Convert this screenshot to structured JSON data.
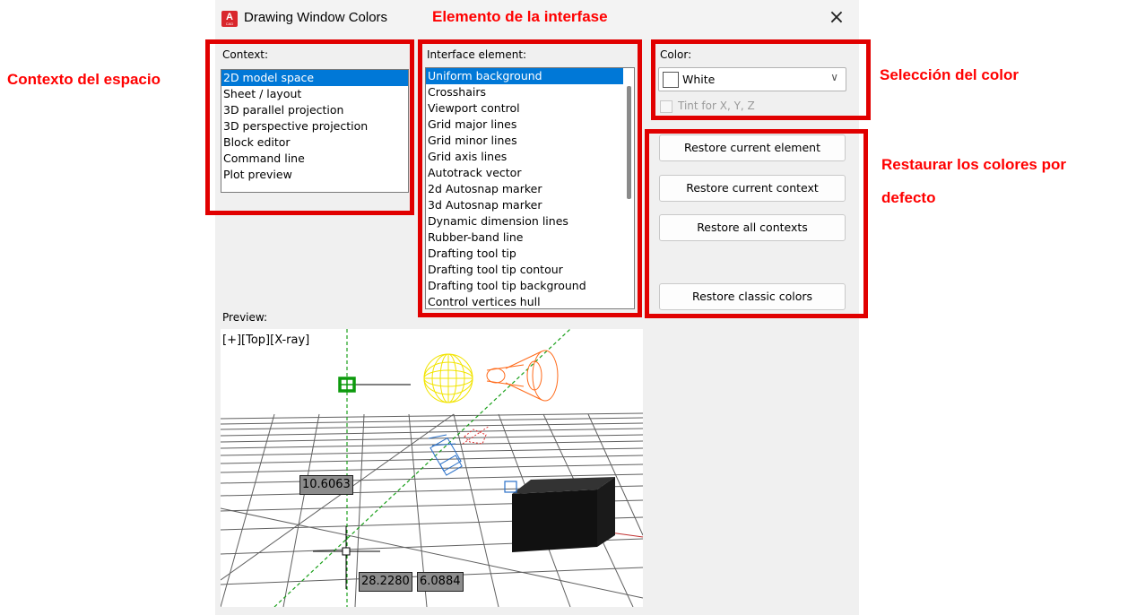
{
  "window": {
    "title": "Drawing Window Colors",
    "close_icon": "×"
  },
  "context": {
    "label": "Context:",
    "items": [
      "2D model space",
      "Sheet / layout",
      "3D parallel projection",
      "3D perspective projection",
      "Block editor",
      "Command line",
      "Plot preview"
    ],
    "selected_index": 0
  },
  "interface": {
    "label": "Interface element:",
    "items": [
      "Uniform background",
      "Crosshairs",
      "Viewport control",
      "Grid major lines",
      "Grid minor lines",
      "Grid axis lines",
      "Autotrack vector",
      "2d Autosnap marker",
      "3d Autosnap marker",
      "Dynamic dimension lines",
      "Rubber-band line",
      "Drafting tool tip",
      "Drafting tool tip contour",
      "Drafting tool tip background",
      "Control vertices hull"
    ],
    "selected_index": 0
  },
  "color": {
    "label": "Color:",
    "selected": "White",
    "tint_label": "Tint for X, Y, Z",
    "tint_checked": false
  },
  "buttons": {
    "restore_element": "Restore current element",
    "restore_context": "Restore current context",
    "restore_all": "Restore all contexts",
    "restore_classic": "Restore classic colors"
  },
  "preview": {
    "label": "Preview:",
    "viewport_label": "[+][Top][X-ray]",
    "coord_1": "10.6063",
    "coord_2": "28.2280",
    "coord_3": "6.0884"
  },
  "annotations": {
    "contexto": "Contexto del espacio",
    "elemento": "Elemento de la interfase",
    "seleccion": "Selección del color",
    "restaurar_1": "Restaurar los colores por",
    "restaurar_2": "defecto"
  },
  "colors": {
    "annotation_red": "#e10000",
    "selection_blue": "#0078d7"
  }
}
